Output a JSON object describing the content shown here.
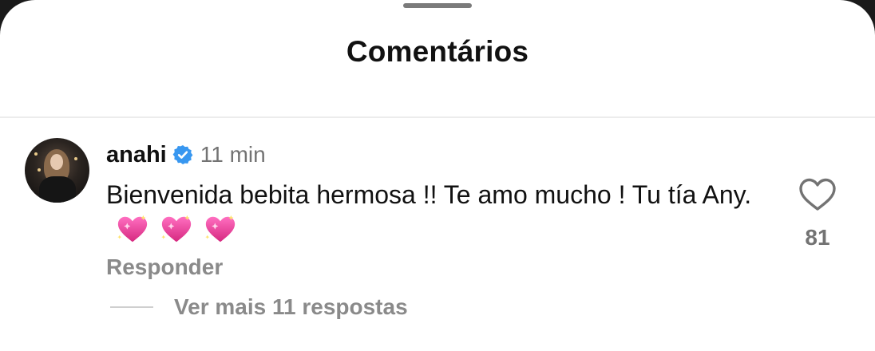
{
  "sheet": {
    "title": "Comentários"
  },
  "comment": {
    "username": "anahi",
    "verified": true,
    "time": "11 min",
    "text": "Bienvenida bebita hermosa !! Te amo mucho ! Tu tía Any.",
    "emojis": [
      "sparkling-heart",
      "sparkling-heart",
      "sparkling-heart"
    ],
    "like_count": "81",
    "reply_label": "Responder",
    "view_replies_label": "Ver mais 11 respostas"
  },
  "colors": {
    "verified_blue": "#3897f0",
    "secondary_text": "#737373",
    "heart_pink": "#e83e9a"
  }
}
